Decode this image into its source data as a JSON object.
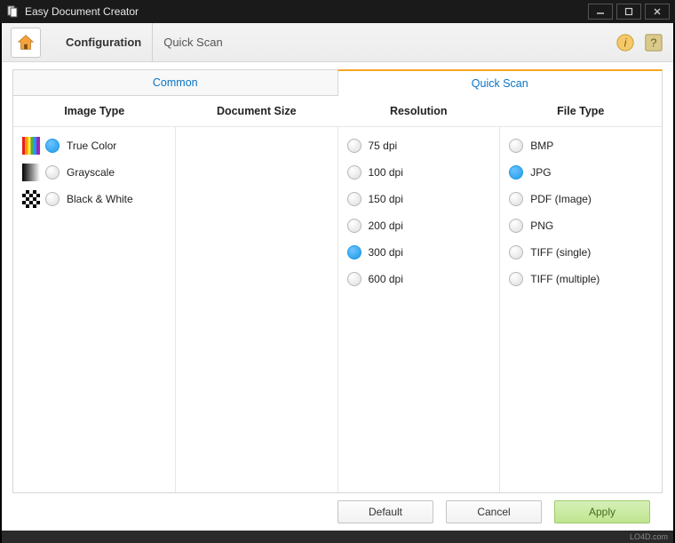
{
  "window": {
    "title": "Easy Document Creator"
  },
  "toolbar": {
    "breadcrumb_main": "Configuration",
    "breadcrumb_sub": "Quick Scan"
  },
  "tabs": {
    "common": "Common",
    "quickscan": "Quick Scan"
  },
  "headers": {
    "image_type": "Image Type",
    "document_size": "Document Size",
    "resolution": "Resolution",
    "file_type": "File Type"
  },
  "image_type": {
    "options": [
      {
        "label": "True Color",
        "selected": true,
        "swatch": "sw-truecolor"
      },
      {
        "label": "Grayscale",
        "selected": false,
        "swatch": "sw-gray"
      },
      {
        "label": "Black & White",
        "selected": false,
        "swatch": "sw-bw"
      }
    ]
  },
  "resolution": {
    "options": [
      {
        "label": "75 dpi",
        "selected": false
      },
      {
        "label": "100 dpi",
        "selected": false
      },
      {
        "label": "150 dpi",
        "selected": false
      },
      {
        "label": "200 dpi",
        "selected": false
      },
      {
        "label": "300 dpi",
        "selected": true
      },
      {
        "label": "600 dpi",
        "selected": false
      }
    ]
  },
  "file_type": {
    "options": [
      {
        "label": "BMP",
        "selected": false
      },
      {
        "label": "JPG",
        "selected": true
      },
      {
        "label": "PDF (Image)",
        "selected": false
      },
      {
        "label": "PNG",
        "selected": false
      },
      {
        "label": "TIFF (single)",
        "selected": false
      },
      {
        "label": "TIFF (multiple)",
        "selected": false
      }
    ]
  },
  "footer": {
    "default": "Default",
    "cancel": "Cancel",
    "apply": "Apply"
  },
  "statusbar": {
    "text": "LO4D.com"
  }
}
